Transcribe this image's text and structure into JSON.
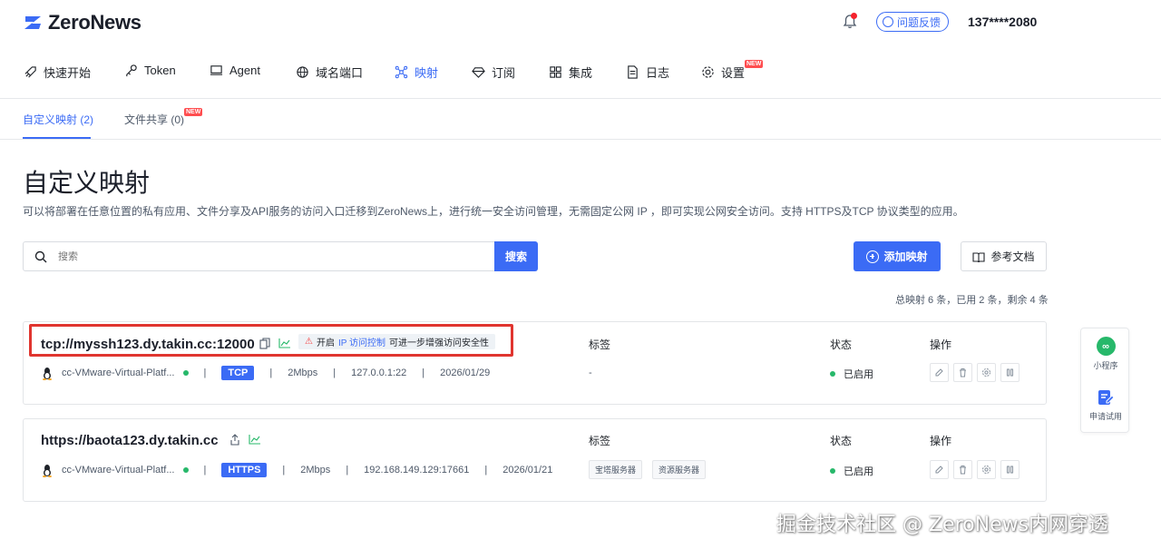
{
  "header": {
    "logo_text": "ZeroNews",
    "feedback_label": "问题反馈",
    "user": "137****2080",
    "brand_color": "#3b6bf5"
  },
  "nav": {
    "items": [
      {
        "label": "快速开始",
        "icon": "rocket-icon"
      },
      {
        "label": "Token",
        "icon": "key-icon"
      },
      {
        "label": "Agent",
        "icon": "monitor-icon"
      },
      {
        "label": "域名端口",
        "icon": "globe-icon"
      },
      {
        "label": "映射",
        "icon": "mapping-icon",
        "active": true
      },
      {
        "label": "订阅",
        "icon": "diamond-icon"
      },
      {
        "label": "集成",
        "icon": "grid-icon"
      },
      {
        "label": "日志",
        "icon": "doc-icon"
      },
      {
        "label": "设置",
        "icon": "gear-icon",
        "badge": "NEW"
      }
    ]
  },
  "subtabs": {
    "custom": "自定义映射 (2)",
    "share": "文件共享 (0)",
    "share_badge": "NEW"
  },
  "page": {
    "title": "自定义映射",
    "description": "可以将部署在任意位置的私有应用、文件分享及API服务的访问入口迁移到ZeroNews上，进行统一安全访问管理，无需固定公网 IP ，即可实现公网安全访问。支持 HTTPS及TCP 协议类型的应用。"
  },
  "search": {
    "placeholder": "搜索",
    "button": "搜索"
  },
  "actions": {
    "add": "添加映射",
    "docs": "参考文档"
  },
  "quota": "总映射 6 条，已用 2 条，剩余 4 条",
  "columns": {
    "tags": "标签",
    "status": "状态",
    "ops": "操作"
  },
  "mappings": [
    {
      "address": "tcp://myssh123.dy.takin.cc:12000",
      "hint_prefix": "开启",
      "hint_link": "IP 访问控制",
      "hint_suffix": "可进一步增强访问安全性",
      "agent": "cc-VMware-Virtual-Platf...",
      "protocol": "TCP",
      "bandwidth": "2Mbps",
      "target": "127.0.0.1:22",
      "date": "2026/01/29",
      "tags_text": "-",
      "status": "已启用"
    },
    {
      "address": "https://baota123.dy.takin.cc",
      "agent": "cc-VMware-Virtual-Platf...",
      "protocol": "HTTPS",
      "bandwidth": "2Mbps",
      "target": "192.168.149.129:17661",
      "date": "2026/01/21",
      "tags": [
        "宝塔服务器",
        "资源服务器"
      ],
      "status": "已启用"
    }
  ],
  "side_panel": {
    "mini_program": "小程序",
    "trial": "申请试用"
  },
  "watermark": "掘金技术社区 @ ZeroNews内网穿透"
}
